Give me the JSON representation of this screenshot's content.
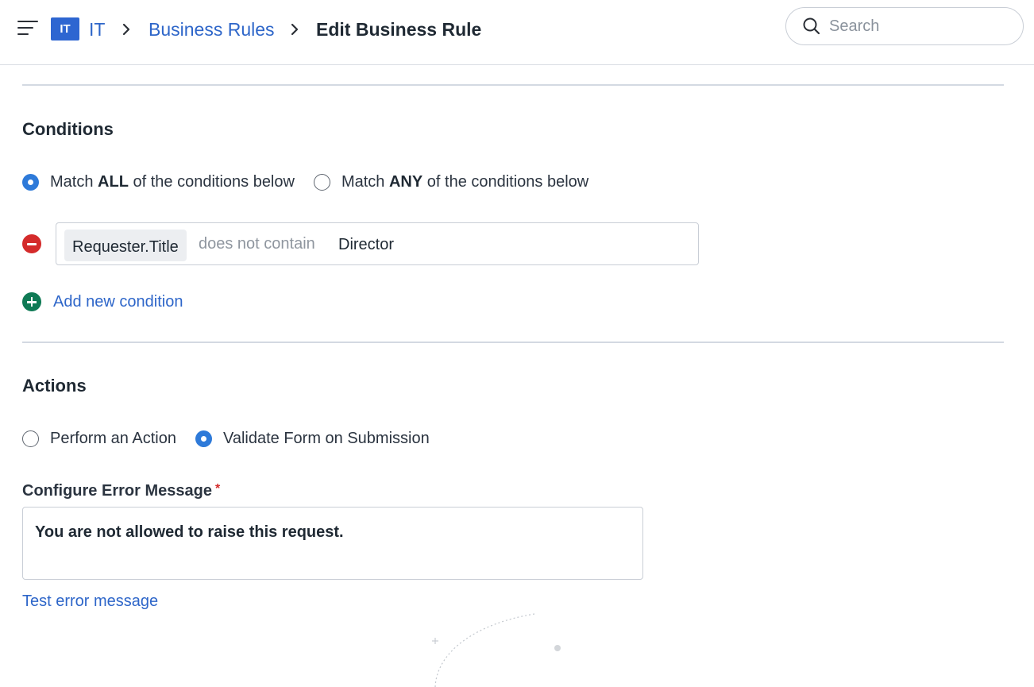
{
  "header": {
    "workspace_badge": "IT",
    "breadcrumb": [
      {
        "label": "IT"
      },
      {
        "label": "Business Rules"
      }
    ],
    "current_page": "Edit Business Rule",
    "search": {
      "placeholder": "Search"
    }
  },
  "conditions": {
    "title": "Conditions",
    "match_options": [
      {
        "prefix": "Match ",
        "keyword": "ALL",
        "suffix": " of the conditions below",
        "selected": true
      },
      {
        "prefix": "Match ",
        "keyword": "ANY",
        "suffix": " of the conditions below",
        "selected": false
      }
    ],
    "rows": [
      {
        "field": "Requester.Title",
        "operator": "does not contain",
        "value": "Director"
      }
    ],
    "add_label": "Add new condition"
  },
  "actions": {
    "title": "Actions",
    "options": [
      {
        "label": "Perform an Action",
        "selected": false
      },
      {
        "label": "Validate Form on Submission",
        "selected": true
      }
    ],
    "error_message": {
      "label": "Configure Error Message",
      "required_mark": "*",
      "value": "You are not allowed to raise this request."
    },
    "test_link": "Test error message"
  },
  "colors": {
    "accent": "#2e7ad9",
    "link": "#2e66c9",
    "badge": "#2e66d1",
    "remove": "#d42b2b",
    "add": "#0f7a55"
  }
}
